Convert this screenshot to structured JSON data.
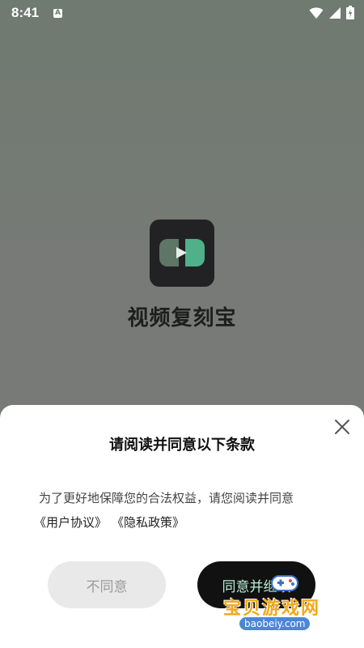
{
  "status_bar": {
    "time": "8:41",
    "notification_letter": "A",
    "icons": [
      "wifi-icon",
      "signal-icon",
      "battery-icon"
    ]
  },
  "splash": {
    "app_name": "视频复刻宝",
    "icon_colors": {
      "background": "#222224",
      "left": "#5f7566",
      "right": "#4fb08a"
    }
  },
  "dialog": {
    "title": "请阅读并同意以下条款",
    "description": "为了更好地保障您的合法权益，请您阅读并同意",
    "links": [
      "《用户协议》",
      "《隐私政策》"
    ],
    "disagree_label": "不同意",
    "agree_label": "同意并继续"
  },
  "watermark": {
    "text": "宝贝游戏网",
    "url": "baobeiy.com"
  },
  "colors": {
    "accent_text": "#b7eed7",
    "agree_bg": "#111111",
    "disagree_bg": "#e9e9e9"
  }
}
